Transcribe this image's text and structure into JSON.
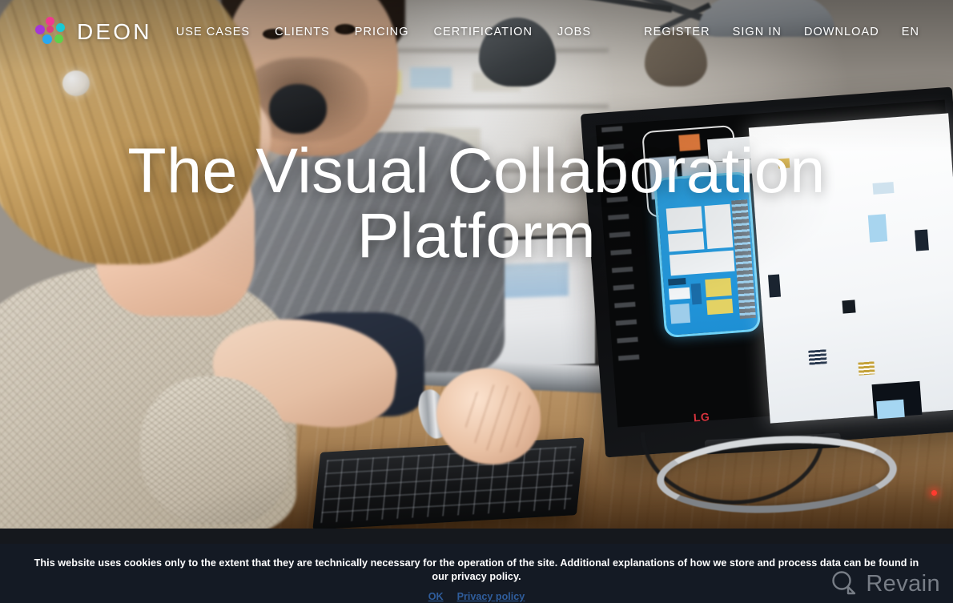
{
  "brand": {
    "name": "DEON",
    "logo_icon": "deon-dots-logo",
    "dot_colors": [
      "#ef3a8e",
      "#18c9d4",
      "#a437d6",
      "#29a8f0",
      "#5fd04a",
      "#e0367f"
    ]
  },
  "nav": {
    "main_items": [
      {
        "label": "USE CASES",
        "name": "use-cases"
      },
      {
        "label": "CLIENTS",
        "name": "clients"
      },
      {
        "label": "PRICING",
        "name": "pricing"
      },
      {
        "label": "CERTIFICATION",
        "name": "certification"
      },
      {
        "label": "JOBS",
        "name": "jobs"
      }
    ],
    "right_items": [
      {
        "label": "REGISTER",
        "name": "register"
      },
      {
        "label": "SIGN IN",
        "name": "sign-in"
      },
      {
        "label": "DOWNLOAD",
        "name": "download"
      },
      {
        "label": "EN",
        "name": "language"
      }
    ]
  },
  "hero": {
    "title_line1": "The Visual Collaboration",
    "title_line2": "Platform",
    "monitor_brand": "LG"
  },
  "cookie": {
    "message": "This website uses cookies only to the extent that they are technically necessary for the operation of the site. Additional explanations of how we store and process data can be found in our privacy policy.",
    "ok_label": "OK",
    "privacy_label": "Privacy policy",
    "link_color": "#2f5d9c",
    "background": "#141a24"
  },
  "watermark": {
    "label": "Revain",
    "icon": "magnifier-icon"
  }
}
